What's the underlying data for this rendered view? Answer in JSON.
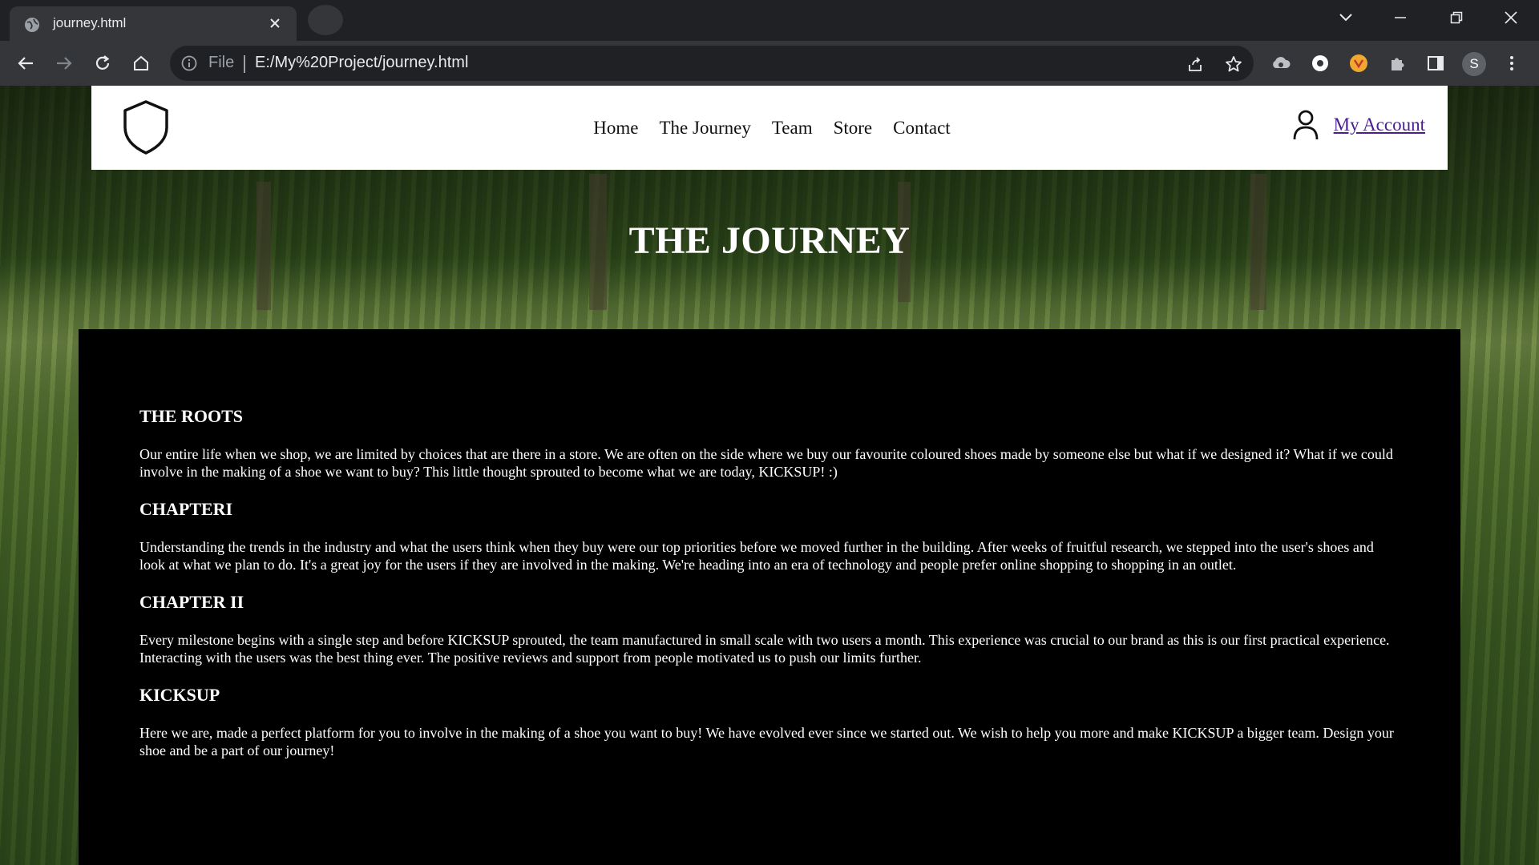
{
  "browser": {
    "tab_title": "journey.html",
    "address_scheme": "File",
    "address_url": "E:/My%20Project/journey.html",
    "profile_initial": "S"
  },
  "site": {
    "nav": [
      "Home",
      "The Journey",
      "Team",
      "Store",
      "Contact"
    ],
    "account_label": "My Account",
    "hero_title": "THE JOURNEY"
  },
  "sections": [
    {
      "heading": "THE ROOTS",
      "text": "Our entire life when we shop, we are limited by choices that are there in a store. We are often on the side where we buy our favourite coloured shoes made by someone else but what if we designed it? What if we could involve in the making of a shoe we want to buy? This little thought sprouted to become what we are today, KICKSUP! :)"
    },
    {
      "heading": "CHAPTERI",
      "text": "Understanding the trends in the industry and what the users think when they buy were our top priorities before we moved further in the building. After weeks of fruitful research, we stepped into the user's shoes and look at what we plan to do. It's a great joy for the users if they are involved in the making. We're heading into an era of technology and people prefer online shopping to shopping in an outlet."
    },
    {
      "heading": "CHAPTER II",
      "text": "Every milestone begins with a single step and before KICKSUP sprouted, the team manufactured in small scale with two users a month. This experience was crucial to our brand as this is our first practical experience. Interacting with the users was the best thing ever. The positive reviews and support from people motivated us to push our limits further."
    },
    {
      "heading": "KICKSUP",
      "text": "Here we are, made a perfect platform for you to involve in the making of a shoe you want to buy! We have evolved ever since we started out. We wish to help you more and make KICKSUP a bigger team. Design your shoe and be a part of our journey!"
    }
  ],
  "icons": {
    "logo": "shield-icon",
    "account": "user-icon"
  },
  "colors": {
    "chrome_dark": "#202124",
    "chrome_toolbar": "#35363a",
    "content_bg": "#000000",
    "header_bg": "#ffffff",
    "account_link": "#4b1d8f"
  }
}
